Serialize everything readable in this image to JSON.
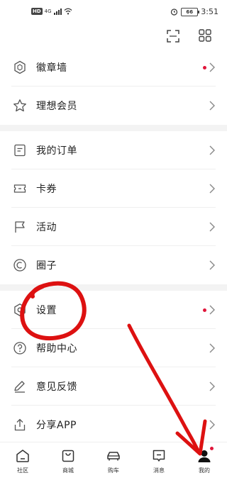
{
  "status_bar": {
    "network_badge": "HD",
    "signal_label": "4G",
    "battery": "66",
    "time": "3:51"
  },
  "top_actions": {
    "scan_icon": "scan-icon",
    "grid_icon": "apps-grid-icon"
  },
  "menu": {
    "section1": [
      {
        "label": "徽章墙",
        "icon": "badge-icon",
        "has_dot": true
      },
      {
        "label": "理想会员",
        "icon": "star-icon",
        "has_dot": false
      }
    ],
    "section2": [
      {
        "label": "我的订单",
        "icon": "order-icon",
        "has_dot": false
      },
      {
        "label": "卡券",
        "icon": "coupon-icon",
        "has_dot": false
      },
      {
        "label": "活动",
        "icon": "flag-icon",
        "has_dot": false
      },
      {
        "label": "圈子",
        "icon": "circle-icon",
        "has_dot": false
      }
    ],
    "section3": [
      {
        "label": "设置",
        "icon": "settings-icon",
        "has_dot": true
      },
      {
        "label": "帮助中心",
        "icon": "help-icon",
        "has_dot": false
      },
      {
        "label": "意见反馈",
        "icon": "feedback-icon",
        "has_dot": false
      },
      {
        "label": "分享APP",
        "icon": "share-icon",
        "has_dot": false
      }
    ]
  },
  "bottom_nav": [
    {
      "label": "社区",
      "icon": "home-icon"
    },
    {
      "label": "商城",
      "icon": "shop-bag-icon"
    },
    {
      "label": "购车",
      "icon": "car-icon"
    },
    {
      "label": "消息",
      "icon": "message-icon"
    },
    {
      "label": "我的",
      "icon": "user-icon",
      "badge": true
    }
  ],
  "colors": {
    "accent_red": "#e0153a",
    "annotation_red": "#dd1111",
    "separator": "#f3f3f3"
  }
}
